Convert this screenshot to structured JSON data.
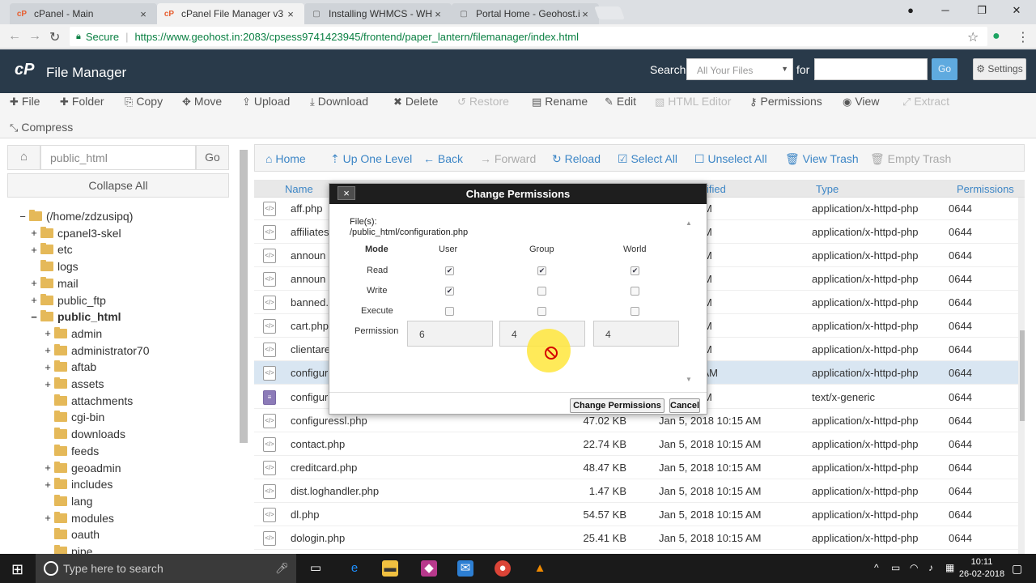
{
  "browser": {
    "tabs": [
      {
        "label": "cPanel - Main",
        "active": false
      },
      {
        "label": "cPanel File Manager v3",
        "active": true
      },
      {
        "label": "Installing WHMCS - WH",
        "active": false
      },
      {
        "label": "Portal Home - Geohost.in",
        "active": false
      }
    ],
    "secure_label": "Secure",
    "url": "https://www.geohost.in:2083/cpsess9741423945/frontend/paper_lantern/filemanager/index.html"
  },
  "header": {
    "title": "File Manager",
    "search_label": "Search",
    "search_scope": "All Your Files",
    "for_label": "for",
    "go_label": "Go",
    "settings_label": "Settings"
  },
  "toolbar": {
    "file": "File",
    "folder": "Folder",
    "copy": "Copy",
    "move": "Move",
    "upload": "Upload",
    "download": "Download",
    "delete": "Delete",
    "restore": "Restore",
    "rename": "Rename",
    "edit": "Edit",
    "html_editor": "HTML Editor",
    "permissions": "Permissions",
    "view": "View",
    "extract": "Extract",
    "compress": "Compress"
  },
  "left": {
    "path": "public_html",
    "go": "Go",
    "collapse_all": "Collapse All",
    "tree": [
      {
        "toggle": "−",
        "label": "(/home/zdzusipq)",
        "depth": 0,
        "bold": false
      },
      {
        "toggle": "+",
        "label": "cpanel3-skel",
        "depth": 1,
        "bold": false
      },
      {
        "toggle": "+",
        "label": "etc",
        "depth": 1,
        "bold": false
      },
      {
        "toggle": "",
        "label": "logs",
        "depth": 1,
        "bold": false
      },
      {
        "toggle": "+",
        "label": "mail",
        "depth": 1,
        "bold": false
      },
      {
        "toggle": "+",
        "label": "public_ftp",
        "depth": 1,
        "bold": false
      },
      {
        "toggle": "−",
        "label": "public_html",
        "depth": 1,
        "bold": true
      },
      {
        "toggle": "+",
        "label": "admin",
        "depth": 2,
        "bold": false
      },
      {
        "toggle": "+",
        "label": "administrator70",
        "depth": 2,
        "bold": false
      },
      {
        "toggle": "+",
        "label": "aftab",
        "depth": 2,
        "bold": false
      },
      {
        "toggle": "+",
        "label": "assets",
        "depth": 2,
        "bold": false
      },
      {
        "toggle": "",
        "label": "attachments",
        "depth": 2,
        "bold": false
      },
      {
        "toggle": "",
        "label": "cgi-bin",
        "depth": 2,
        "bold": false
      },
      {
        "toggle": "",
        "label": "downloads",
        "depth": 2,
        "bold": false
      },
      {
        "toggle": "",
        "label": "feeds",
        "depth": 2,
        "bold": false
      },
      {
        "toggle": "+",
        "label": "geoadmin",
        "depth": 2,
        "bold": false
      },
      {
        "toggle": "+",
        "label": "includes",
        "depth": 2,
        "bold": false
      },
      {
        "toggle": "",
        "label": "lang",
        "depth": 2,
        "bold": false
      },
      {
        "toggle": "+",
        "label": "modules",
        "depth": 2,
        "bold": false
      },
      {
        "toggle": "",
        "label": "oauth",
        "depth": 2,
        "bold": false
      },
      {
        "toggle": "",
        "label": "pipe",
        "depth": 2,
        "bold": false
      }
    ]
  },
  "right_toolbar": {
    "home": "Home",
    "up": "Up One Level",
    "back": "Back",
    "forward": "Forward",
    "reload": "Reload",
    "select_all": "Select All",
    "unselect_all": "Unselect All",
    "view_trash": "View Trash",
    "empty_trash": "Empty Trash"
  },
  "table": {
    "headers": {
      "name": "Name",
      "modified": "ified",
      "type": "Type",
      "permissions": "Permissions"
    },
    "rows": [
      {
        "name": "aff.php",
        "size": "",
        "date": "8 10:15 AM",
        "type": "application/x-httpd-php",
        "perm": "0644",
        "kind": "php",
        "selected": false
      },
      {
        "name": "affiliates",
        "size": "",
        "date": "8 10:15 AM",
        "type": "application/x-httpd-php",
        "perm": "0644",
        "kind": "php",
        "selected": false
      },
      {
        "name": "announ",
        "size": "",
        "date": "8 10:15 AM",
        "type": "application/x-httpd-php",
        "perm": "0644",
        "kind": "php",
        "selected": false
      },
      {
        "name": "announ",
        "size": "",
        "date": "8 10:15 AM",
        "type": "application/x-httpd-php",
        "perm": "0644",
        "kind": "php",
        "selected": false
      },
      {
        "name": "banned.",
        "size": "",
        "date": "8 10:15 AM",
        "type": "application/x-httpd-php",
        "perm": "0644",
        "kind": "php",
        "selected": false
      },
      {
        "name": "cart.php",
        "size": "",
        "date": "8 10:15 AM",
        "type": "application/x-httpd-php",
        "perm": "0644",
        "kind": "php",
        "selected": false
      },
      {
        "name": "clientare",
        "size": "",
        "date": "8 10:15 AM",
        "type": "application/x-httpd-php",
        "perm": "0644",
        "kind": "php",
        "selected": false
      },
      {
        "name": "configur",
        "size": "",
        "date": "018 9:50 AM",
        "type": "application/x-httpd-php",
        "perm": "0644",
        "kind": "php",
        "selected": true
      },
      {
        "name": "configur",
        "size": "",
        "date": "8 10:15 AM",
        "type": "text/x-generic",
        "perm": "0644",
        "kind": "txt",
        "selected": false
      },
      {
        "name": "configuressl.php",
        "size": "47.02 KB",
        "date": "Jan 5, 2018 10:15 AM",
        "type": "application/x-httpd-php",
        "perm": "0644",
        "kind": "php",
        "selected": false
      },
      {
        "name": "contact.php",
        "size": "22.74 KB",
        "date": "Jan 5, 2018 10:15 AM",
        "type": "application/x-httpd-php",
        "perm": "0644",
        "kind": "php",
        "selected": false
      },
      {
        "name": "creditcard.php",
        "size": "48.47 KB",
        "date": "Jan 5, 2018 10:15 AM",
        "type": "application/x-httpd-php",
        "perm": "0644",
        "kind": "php",
        "selected": false
      },
      {
        "name": "dist.loghandler.php",
        "size": "1.47 KB",
        "date": "Jan 5, 2018 10:15 AM",
        "type": "application/x-httpd-php",
        "perm": "0644",
        "kind": "php",
        "selected": false
      },
      {
        "name": "dl.php",
        "size": "54.57 KB",
        "date": "Jan 5, 2018 10:15 AM",
        "type": "application/x-httpd-php",
        "perm": "0644",
        "kind": "php",
        "selected": false
      },
      {
        "name": "dologin.php",
        "size": "25.41 KB",
        "date": "Jan 5, 2018 10:15 AM",
        "type": "application/x-httpd-php",
        "perm": "0644",
        "kind": "php",
        "selected": false
      }
    ]
  },
  "dialog": {
    "title": "Change Permissions",
    "close": "×",
    "files_label": "File(s):",
    "file_path": "/public_html/configuration.php",
    "mode_label": "Mode",
    "columns": [
      "User",
      "Group",
      "World"
    ],
    "rows": [
      {
        "label": "Read",
        "checks": [
          true,
          true,
          true
        ]
      },
      {
        "label": "Write",
        "checks": [
          true,
          false,
          false
        ]
      },
      {
        "label": "Execute",
        "checks": [
          false,
          false,
          false
        ]
      }
    ],
    "permission_label": "Permission",
    "permission_values": [
      "6",
      "4",
      "4"
    ],
    "submit": "Change Permissions",
    "cancel": "Cancel"
  },
  "taskbar": {
    "search_placeholder": "Type here to search",
    "time": "10:11",
    "date": "26-02-2018"
  }
}
